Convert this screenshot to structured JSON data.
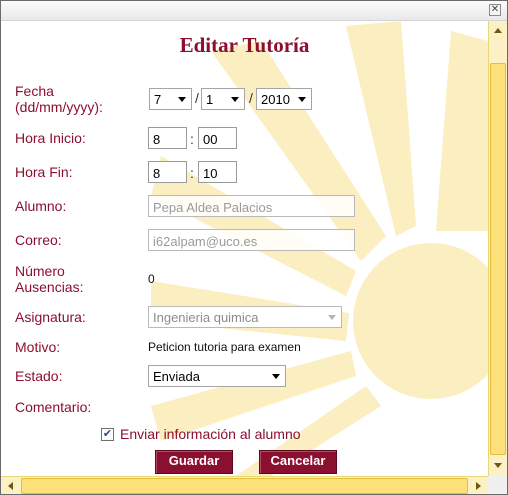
{
  "window": {
    "close_glyph": "✕"
  },
  "title": "Editar Tutoría",
  "labels": {
    "fecha_line1": "Fecha",
    "fecha_line2": "(dd/mm/yyyy):",
    "hora_inicio": "Hora Inicio:",
    "hora_fin": "Hora Fin:",
    "alumno": "Alumno:",
    "correo": "Correo:",
    "ausencias_line1": "Número",
    "ausencias_line2": "Ausencias:",
    "asignatura": "Asignatura:",
    "motivo": "Motivo:",
    "estado": "Estado:",
    "comentario": "Comentario:"
  },
  "fecha": {
    "day": "7",
    "month": "1",
    "year": "2010",
    "separator": "/"
  },
  "hora_inicio": {
    "hour": "8",
    "minute": "00"
  },
  "hora_fin": {
    "hour": "8",
    "minute": "10"
  },
  "time_separator": ":",
  "alumno": "Pepa Aldea Palacios",
  "correo": "i62alpam@uco.es",
  "ausencias": "0",
  "asignatura": "Ingenieria quimica",
  "motivo": "Peticion tutoria para examen",
  "estado": "Enviada",
  "enviar_info": {
    "checked": true,
    "check_glyph": "✔",
    "label": "Enviar información al alumno"
  },
  "buttons": {
    "guardar": "Guardar",
    "cancelar": "Cancelar"
  },
  "colors": {
    "accent": "#8b1030",
    "scrollbar": "#fde07a",
    "watermark": "#fbeec0"
  },
  "icons": {
    "close": "close-icon",
    "dropdown": "chevron-down-icon",
    "check": "check-icon"
  }
}
